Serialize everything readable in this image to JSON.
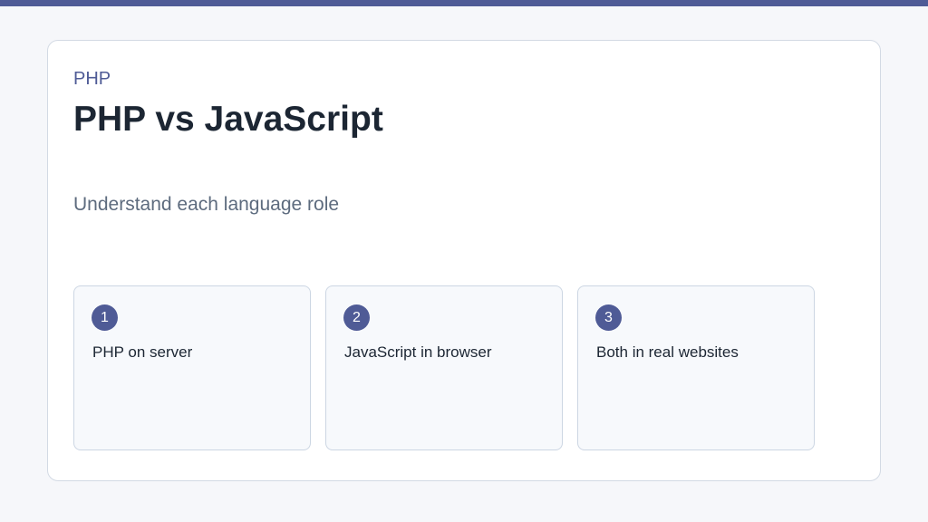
{
  "colors": {
    "accent": "#4f5b96",
    "background": "#f6f7fa",
    "card": "#ffffff",
    "title": "#1c2633",
    "subtitle": "#5d6b7e"
  },
  "slide": {
    "eyebrow": "PHP",
    "title": "PHP vs JavaScript",
    "subtitle": "Understand each language role"
  },
  "steps": [
    {
      "number": "1",
      "label": "PHP on server"
    },
    {
      "number": "2",
      "label": "JavaScript in browser"
    },
    {
      "number": "3",
      "label": "Both in real websites"
    }
  ]
}
